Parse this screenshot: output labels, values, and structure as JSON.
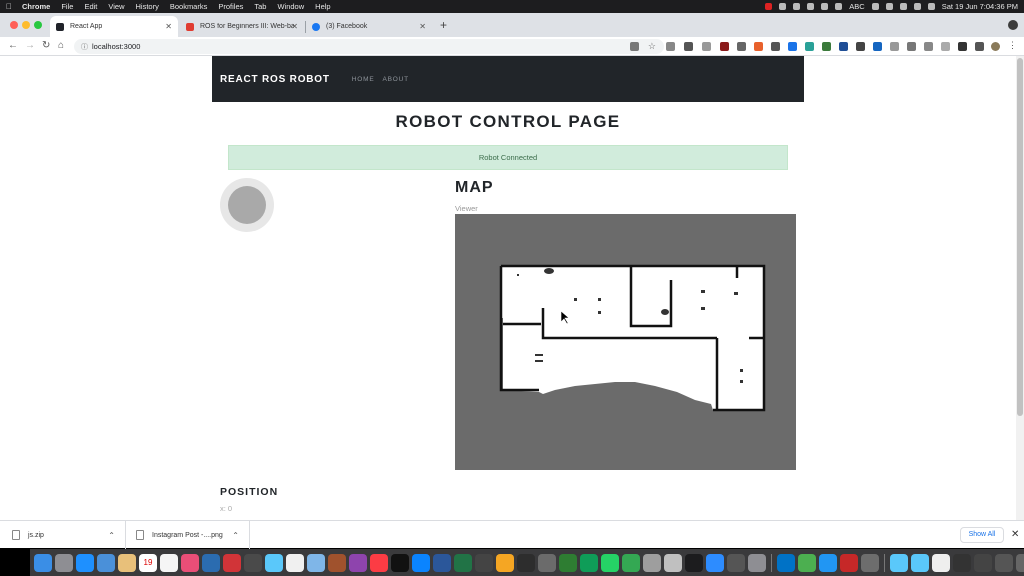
{
  "menubar": {
    "items": [
      "Chrome",
      "File",
      "Edit",
      "View",
      "History",
      "Bookmarks",
      "Profiles",
      "Tab",
      "Window",
      "Help"
    ],
    "input_source": "ABC",
    "clock": "Sat 19 Jun  7:04:36 PM"
  },
  "tabs": [
    {
      "title": "React App",
      "active": true,
      "favicon_color": "#20232a"
    },
    {
      "title": "ROS for Beginners III: Web-ba...",
      "active": false,
      "favicon_color": "#e03c31"
    },
    {
      "title": "(3) Facebook",
      "active": false,
      "favicon_color": "#1877f2"
    }
  ],
  "toolbar": {
    "url": "localhost:3000"
  },
  "app": {
    "brand": "REACT ROS ROBOT",
    "nav_links": [
      "HOME",
      "ABOUT"
    ],
    "page_title": "ROBOT CONTROL PAGE",
    "connection_status": "Robot Connected",
    "map_heading": "MAP",
    "viewer_label": "Viewer",
    "position_heading": "POSITION",
    "position_x": "x: 0"
  },
  "downloads": {
    "items": [
      {
        "name": "js.zip"
      },
      {
        "name": "Instagram Post -....png"
      }
    ],
    "show_all_label": "Show All"
  },
  "colors": {
    "navbar": "#212529",
    "alert_bg": "#d1ecdc",
    "map_unknown": "#6b6b6b",
    "joystick_base": "#e7e7e7",
    "joystick_stick": "#a9a9a9"
  },
  "dock": {
    "calendar_day": "19"
  }
}
